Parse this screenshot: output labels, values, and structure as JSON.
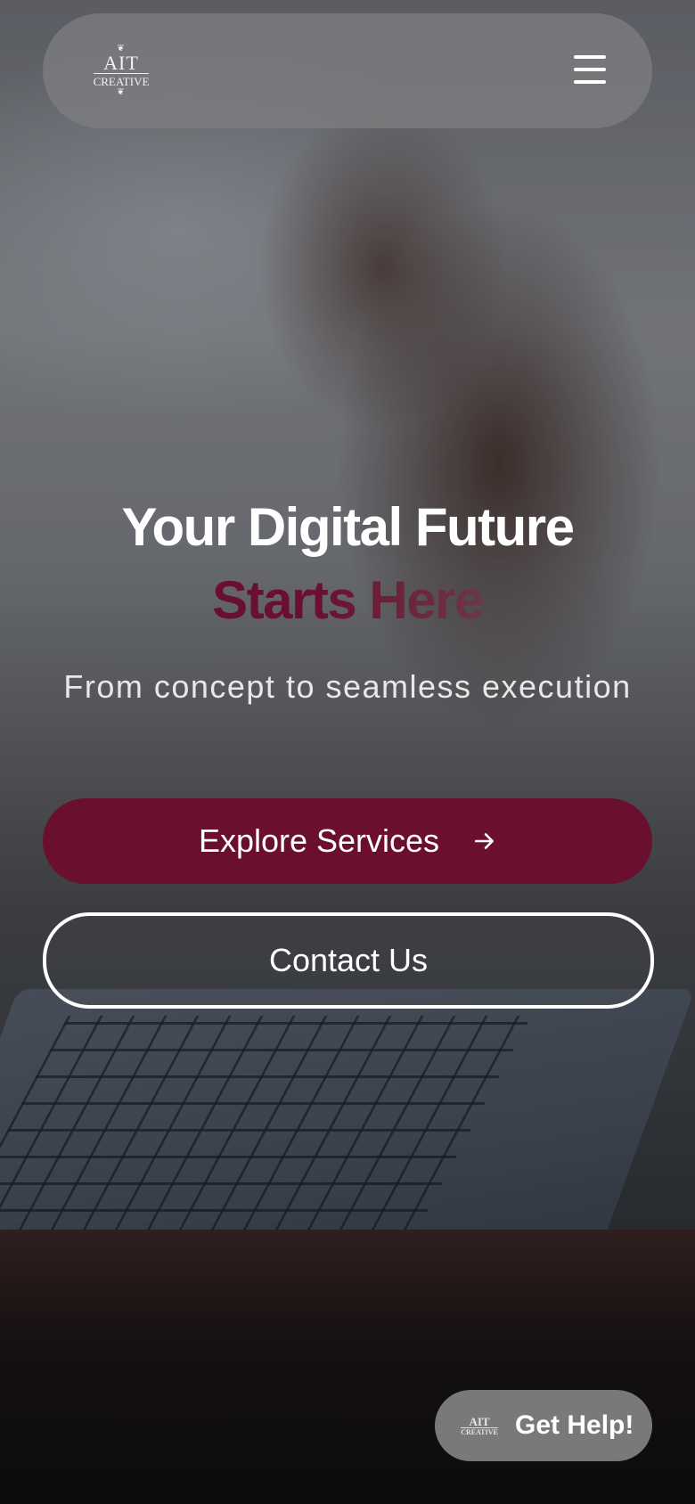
{
  "header": {
    "logo": {
      "line1": "AIT",
      "line2": "CREATIVE",
      "icon": "ait-creative-logo"
    },
    "menu_icon": "hamburger-menu-icon"
  },
  "hero": {
    "title": "Your Digital Future",
    "subtitle": "Starts Here",
    "tagline": "From concept to seamless execution",
    "primary_button": {
      "label": "Explore Services",
      "icon": "arrow-right-icon"
    },
    "secondary_button": {
      "label": "Contact Us"
    }
  },
  "help_widget": {
    "label": "Get Help!",
    "logo": {
      "line1": "AIT",
      "line2": "CREATIVE"
    }
  },
  "colors": {
    "accent": "#6b0f2e",
    "text_light": "#ffffff"
  }
}
